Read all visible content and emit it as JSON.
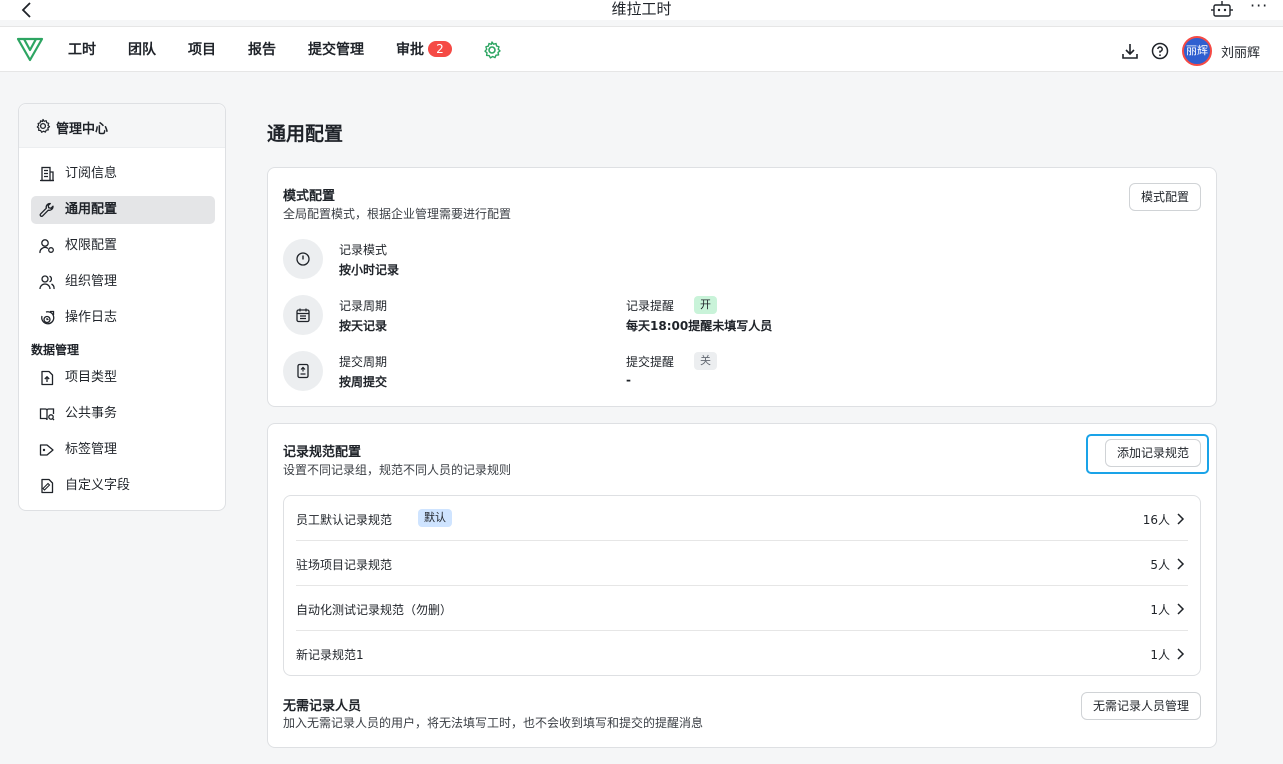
{
  "window": {
    "title": "维拉工时"
  },
  "nav": {
    "items": [
      {
        "label": "工时"
      },
      {
        "label": "团队"
      },
      {
        "label": "项目"
      },
      {
        "label": "报告"
      },
      {
        "label": "提交管理"
      },
      {
        "label": "审批",
        "badge": "2"
      }
    ],
    "avatar_text": "丽辉",
    "username": "刘丽辉",
    "accent_color": "#2da562",
    "badge_color": "#f54a45"
  },
  "sidebar": {
    "header": "管理中心",
    "items": [
      {
        "label": "订阅信息",
        "icon": "building-icon"
      },
      {
        "label": "通用配置",
        "icon": "wrench-icon",
        "active": true
      },
      {
        "label": "权限配置",
        "icon": "user-key-icon"
      },
      {
        "label": "组织管理",
        "icon": "users-icon"
      },
      {
        "label": "操作日志",
        "icon": "log-icon"
      }
    ],
    "group_label": "数据管理",
    "group_items": [
      {
        "label": "项目类型",
        "icon": "project-type-icon"
      },
      {
        "label": "公共事务",
        "icon": "public-affairs-icon"
      },
      {
        "label": "标签管理",
        "icon": "tag-icon"
      },
      {
        "label": "自定义字段",
        "icon": "custom-field-icon"
      }
    ]
  },
  "main": {
    "page_title": "通用配置",
    "mode": {
      "title": "模式配置",
      "desc": "全局配置模式，根据企业管理需要进行配置",
      "button": "模式配置",
      "record_mode_label": "记录模式",
      "record_mode_value": "按小时记录",
      "record_cycle_label": "记录周期",
      "record_cycle_value": "按天记录",
      "record_remind_label": "记录提醒",
      "record_remind_tag": "开",
      "record_remind_value": "每天18:00提醒未填写人员",
      "submit_cycle_label": "提交周期",
      "submit_cycle_value": "按周提交",
      "submit_remind_label": "提交提醒",
      "submit_remind_tag": "关",
      "submit_remind_value": "-"
    },
    "rules": {
      "title": "记录规范配置",
      "desc": "设置不同记录组，规范不同人员的记录规则",
      "button": "添加记录规范",
      "items": [
        {
          "name": "员工默认记录规范",
          "tag": "默认",
          "count": "16人"
        },
        {
          "name": "驻场项目记录规范",
          "count": "5人"
        },
        {
          "name": "自动化测试记录规范（勿删）",
          "count": "1人"
        },
        {
          "name": "新记录规范1",
          "count": "1人"
        }
      ]
    },
    "exempt": {
      "title": "无需记录人员",
      "desc": "加入无需记录人员的用户，将无法填写工时，也不会收到填写和提交的提醒消息",
      "button": "无需记录人员管理"
    }
  }
}
